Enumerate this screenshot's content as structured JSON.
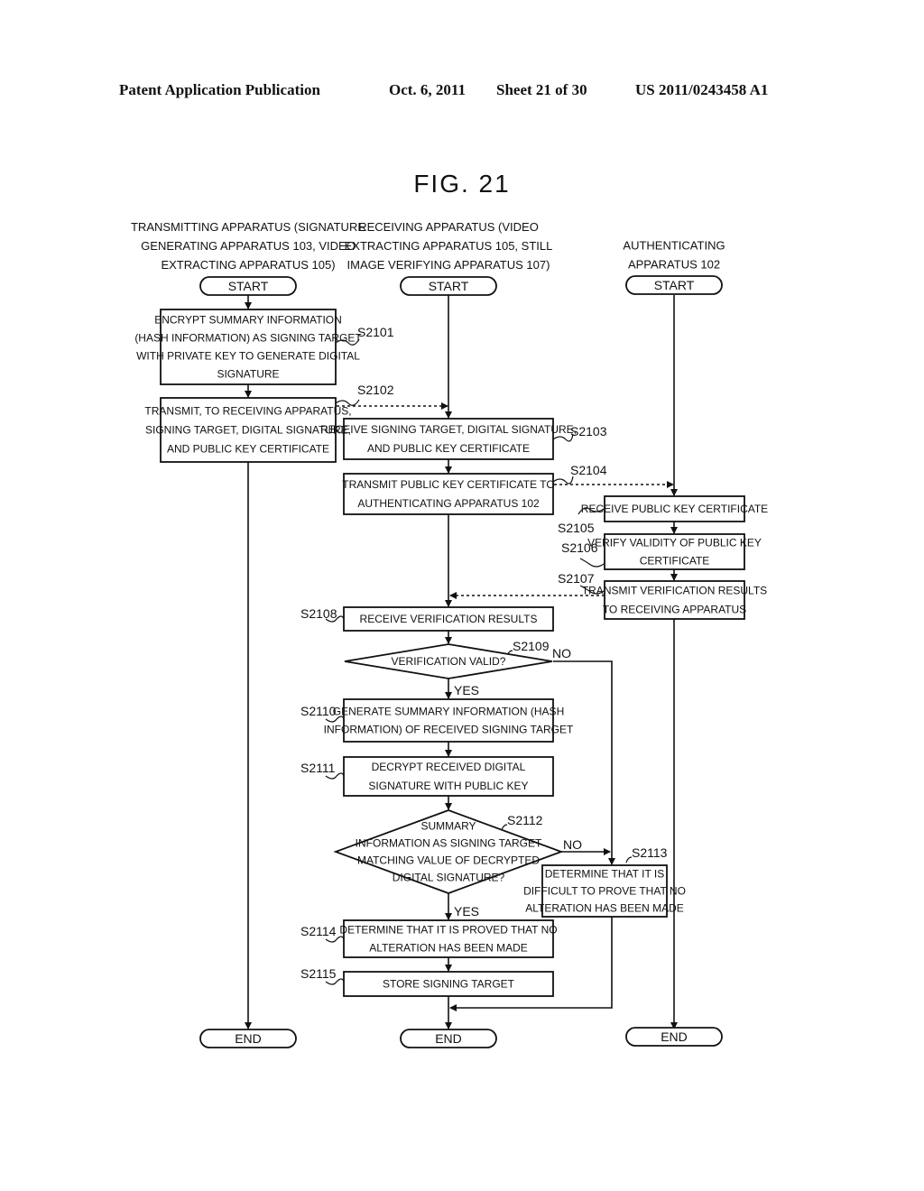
{
  "header": {
    "publication": "Patent Application Publication",
    "date": "Oct. 6, 2011",
    "sheet": "Sheet 21 of 30",
    "number": "US 2011/0243458 A1"
  },
  "figure": {
    "title": "FIG. 21"
  },
  "lanes": [
    {
      "title": [
        "TRANSMITTING APPARATUS (SIGNATURE",
        "GENERATING APPARATUS 103, VIDEO",
        "EXTRACTING APPARATUS 105)"
      ],
      "start": "START",
      "end": "END"
    },
    {
      "title": [
        "RECEIVING APPARATUS (VIDEO",
        "EXTRACTING APPARATUS 105, STILL",
        "IMAGE VERIFYING APPARATUS 107)"
      ],
      "start": "START",
      "end": "END"
    },
    {
      "title": [
        "AUTHENTICATING",
        "APPARATUS 102"
      ],
      "start": "START",
      "end": "END"
    }
  ],
  "steps": {
    "s2101": {
      "id": "S2101",
      "lines": [
        "ENCRYPT SUMMARY INFORMATION",
        "(HASH INFORMATION) AS SIGNING TARGET",
        "WITH PRIVATE KEY TO GENERATE DIGITAL",
        "SIGNATURE"
      ]
    },
    "s2102": {
      "id": "S2102",
      "lines": [
        "TRANSMIT, TO RECEIVING APPARATUS,",
        "SIGNING TARGET, DIGITAL SIGNATURE,",
        "AND PUBLIC KEY CERTIFICATE"
      ]
    },
    "s2103": {
      "id": "S2103",
      "lines": [
        "RECEIVE SIGNING TARGET, DIGITAL SIGNATURE,",
        "AND PUBLIC KEY CERTIFICATE"
      ]
    },
    "s2104": {
      "id": "S2104",
      "lines": [
        "TRANSMIT PUBLIC KEY CERTIFICATE TO",
        "AUTHENTICATING APPARATUS 102"
      ]
    },
    "s2105": {
      "id": "S2105",
      "lines": [
        "RECEIVE PUBLIC KEY CERTIFICATE"
      ]
    },
    "s2106": {
      "id": "S2106",
      "lines": [
        "VERIFY VALIDITY OF PUBLIC KEY",
        "CERTIFICATE"
      ]
    },
    "s2107": {
      "id": "S2107",
      "lines": [
        "TRANSMIT VERIFICATION RESULTS",
        "TO RECEIVING APPARATUS"
      ]
    },
    "s2108": {
      "id": "S2108",
      "lines": [
        "RECEIVE VERIFICATION RESULTS"
      ]
    },
    "s2109": {
      "id": "S2109",
      "lines": [
        "VERIFICATION VALID?"
      ],
      "yes": "YES",
      "no": "NO"
    },
    "s2110": {
      "id": "S2110",
      "lines": [
        "GENERATE SUMMARY INFORMATION (HASH",
        "INFORMATION) OF RECEIVED SIGNING TARGET"
      ]
    },
    "s2111": {
      "id": "S2111",
      "lines": [
        "DECRYPT RECEIVED DIGITAL",
        "SIGNATURE WITH PUBLIC KEY"
      ]
    },
    "s2112": {
      "id": "S2112",
      "lines": [
        "SUMMARY",
        "INFORMATION AS SIGNING TARGET",
        "MATCHING VALUE OF DECRYPTED",
        "DIGITAL SIGNATURE?"
      ],
      "yes": "YES",
      "no": "NO"
    },
    "s2113": {
      "id": "S2113",
      "lines": [
        "DETERMINE THAT IT IS",
        "DIFFICULT TO PROVE THAT NO",
        "ALTERATION HAS BEEN MADE"
      ]
    },
    "s2114": {
      "id": "S2114",
      "lines": [
        "DETERMINE THAT IT IS PROVED THAT NO",
        "ALTERATION HAS BEEN MADE"
      ]
    },
    "s2115": {
      "id": "S2115",
      "lines": [
        "STORE SIGNING TARGET"
      ]
    }
  }
}
